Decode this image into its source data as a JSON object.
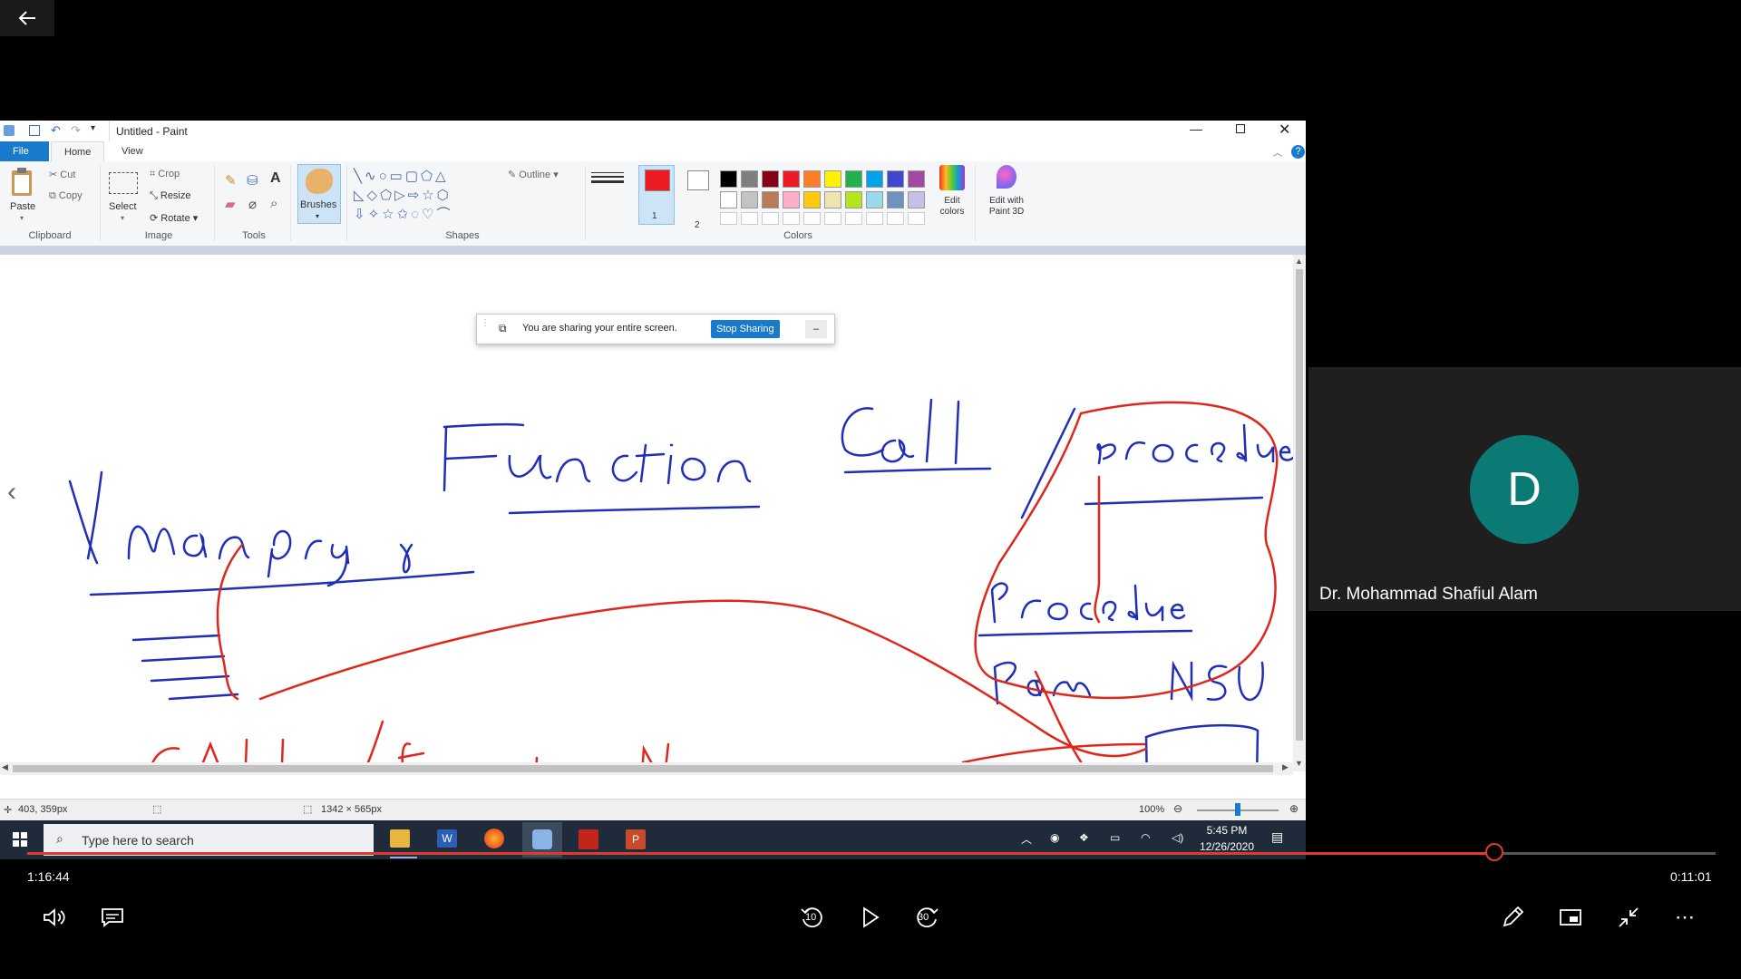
{
  "window": {
    "title": "Untitled - Paint"
  },
  "ribbon": {
    "tabs": [
      "File",
      "Home",
      "View"
    ],
    "clipboard": {
      "paste": "Paste",
      "cut": "Cut",
      "copy": "Copy",
      "group": "Clipboard"
    },
    "image": {
      "select": "Select",
      "crop": "Crop",
      "resize": "Resize",
      "rotate": "Rotate",
      "group": "Image"
    },
    "tools": {
      "group": "Tools"
    },
    "brushes": "Brushes",
    "shapes": {
      "outline": "Outline",
      "group": "Shapes"
    },
    "size": {
      "color1": "1",
      "color2": "2"
    },
    "colors": {
      "group": "Colors",
      "edit": "Edit colors"
    },
    "paint3d": "Edit with Paint 3D",
    "palette": [
      "#000000",
      "#7f7f7f",
      "#880015",
      "#ed1c24",
      "#ff7f27",
      "#fff200",
      "#22b14c",
      "#00a2e8",
      "#3f48cc",
      "#a349a4",
      "#ffffff",
      "#c3c3c3",
      "#b97a57",
      "#ffaec9",
      "#ffc90e",
      "#efe4b0",
      "#b5e61d",
      "#99d9ea",
      "#7092be",
      "#c8bfe7"
    ]
  },
  "share_toast": {
    "message": "You are sharing your entire screen.",
    "button": "Stop Sharing"
  },
  "status": {
    "cursor": "403, 359px",
    "size": "1342 × 565px",
    "zoom": "100%"
  },
  "taskbar": {
    "search_placeholder": "Type here to search",
    "time": "5:45 PM",
    "date": "12/26/2020"
  },
  "participant": {
    "initial": "D",
    "name": "Dr. Mohammad Shafiul Alam"
  },
  "player": {
    "elapsed": "1:16:44",
    "remaining": "0:11:01",
    "progress": 0.869,
    "rewind": "10",
    "forward": "30"
  },
  "colors": {
    "ink_blue": "#1f2fb8",
    "ink_red": "#e0261a",
    "accent": "#e03b2a",
    "avatar": "#0b7a75"
  }
}
